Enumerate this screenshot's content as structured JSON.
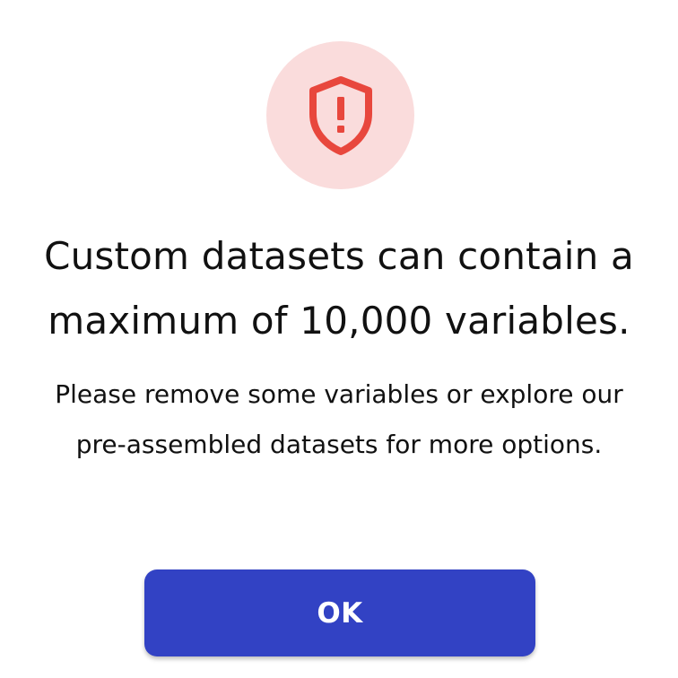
{
  "dialog": {
    "icon": "shield-alert-icon",
    "title_lines": [
      "Custom datasets can contain a",
      "maximum of 10,000 variables."
    ],
    "message_lines": [
      "Please remove some variables or explore our",
      "pre-assembled datasets for more options."
    ],
    "ok_label": "OK"
  },
  "colors": {
    "icon_circle_bg": "#fadcdc",
    "icon_red": "#e8473d",
    "button_bg": "#3242c4",
    "button_text": "#ffffff",
    "text": "#111111"
  }
}
